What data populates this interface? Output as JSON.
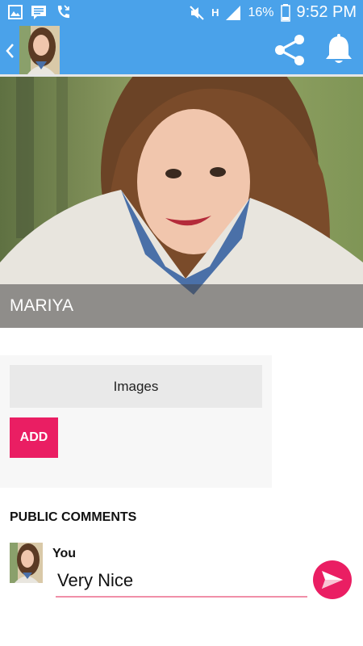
{
  "status_bar": {
    "battery": "16%",
    "time": "9:52 PM",
    "network": "H"
  },
  "app_bar": {
    "color": "#4aa2ea"
  },
  "profile": {
    "name": "MARIYA"
  },
  "images_section": {
    "images_label": "Images",
    "add_label": "ADD"
  },
  "comments": {
    "heading": "PUBLIC COMMENTS",
    "author": "You",
    "input_value": "Very Nice"
  },
  "colors": {
    "accent": "#ea1e63",
    "primary": "#4aa2ea"
  }
}
